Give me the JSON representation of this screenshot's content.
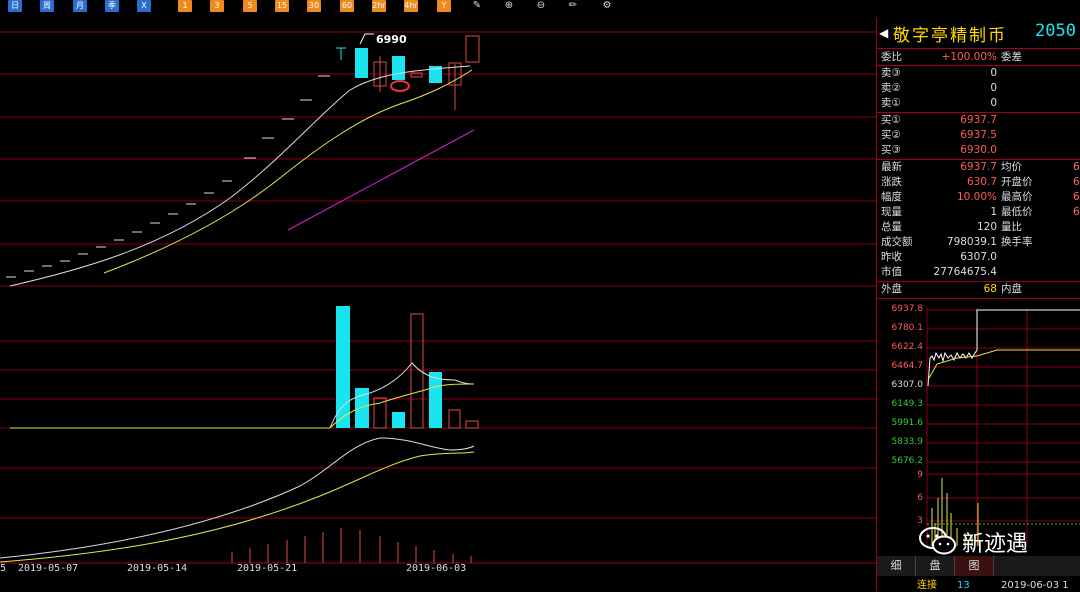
{
  "toolbar": {
    "period_buttons": [
      "日",
      "周",
      "月",
      "季",
      "X"
    ],
    "interval_buttons": [
      "1",
      "3",
      "5",
      "15",
      "30",
      "60",
      "2hr",
      "4hr",
      "Y"
    ]
  },
  "chart": {
    "high_label": "6990",
    "x_labels": [
      "5",
      "2019-05-07",
      "2019-05-14",
      "2019-05-21",
      "2019-06-03"
    ]
  },
  "stock": {
    "name": "敬字亭精制币",
    "code": "2050"
  },
  "quote": {
    "weibi_label": "委比",
    "weibi_value": "+100.00%",
    "weicha_label": "委差",
    "sell3_label": "卖③",
    "sell3_value": "0",
    "sell2_label": "卖②",
    "sell2_value": "0",
    "sell1_label": "卖①",
    "sell1_value": "0",
    "buy1_label": "买①",
    "buy1_value": "6937.7",
    "buy2_label": "买②",
    "buy2_value": "6937.5",
    "buy3_label": "买③",
    "buy3_value": "6930.0",
    "latest_label": "最新",
    "latest_value": "6937.7",
    "avg_label": "均价",
    "avg_value": "6",
    "change_label": "涨跌",
    "change_value": "630.7",
    "open_label": "开盘价",
    "open_value": "6",
    "range_label": "幅度",
    "range_value": "10.00%",
    "high_label": "最高价",
    "high_value": "6",
    "cur_vol_label": "现量",
    "cur_vol_value": "1",
    "low_label": "最低价",
    "low_value": "6",
    "total_vol_label": "总量",
    "total_vol_value": "120",
    "vol_ratio_label": "量比",
    "turnover_label": "成交额",
    "turnover_value": "798039.1",
    "turnover_rate_label": "换手率",
    "prev_close_label": "昨收",
    "prev_close_value": "6307.0",
    "mkt_cap_label": "市值",
    "mkt_cap_value": "27764675.4",
    "outer_label": "外盘",
    "outer_value": "68",
    "inner_label": "内盘"
  },
  "mini_chart": {
    "price_labels": [
      "6937.8",
      "6780.1",
      "6622.4",
      "6464.7",
      "6307.0",
      "6149.3",
      "5991.6",
      "5833.9",
      "5676.2"
    ],
    "volume_labels": [
      "9",
      "6",
      "3"
    ]
  },
  "tabs": [
    "细",
    "盘",
    "图"
  ],
  "bottom": {
    "left_text": "连接",
    "left_num": "13",
    "right_text": "2019-06-03 1"
  },
  "watermark": {
    "text": "新迹遇"
  }
}
